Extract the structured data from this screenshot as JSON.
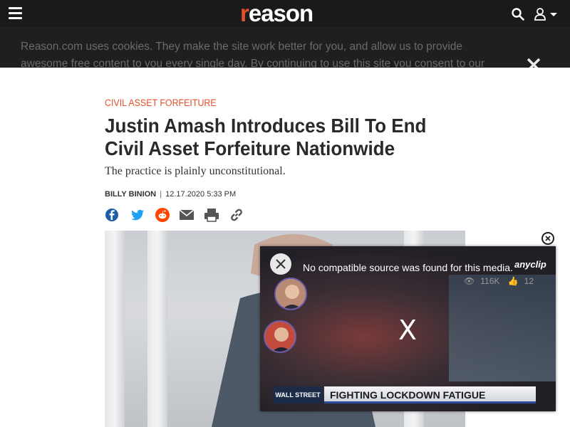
{
  "nav": {
    "logo_text": "reason",
    "brand_color": "#e4502b"
  },
  "cookie_banner": {
    "text": "Reason.com uses cookies. They make the site work better for you, and allow us to provide awesome free content to you every single day. By continuing to use this site you consent to our"
  },
  "article": {
    "section": "Civil Asset Forfeiture",
    "headline": "Justin Amash Introduces Bill To End Civil Asset Forfeiture Nationwide",
    "dek": "The practice is plainly unconstitutional.",
    "author": "Billy Binion",
    "separator": "|",
    "date": "12.17.2020 5:33 PM",
    "share": [
      "facebook-icon",
      "twitter-icon",
      "reddit-icon",
      "email-icon",
      "print-icon",
      "link-icon"
    ]
  },
  "video": {
    "message": "No compatible source was found for this media.",
    "provider": "anyclip",
    "views": "116K",
    "likes": "12",
    "center_mark": "X",
    "lower_third_brand": "WALL STREET",
    "lower_third_text": "FIGHTING LOCKDOWN FATIGUE"
  }
}
